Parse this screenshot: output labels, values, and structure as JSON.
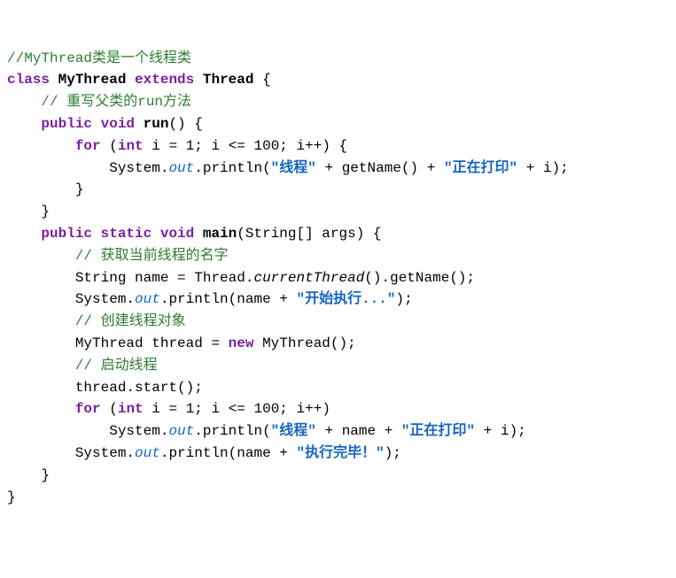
{
  "code": {
    "c1": "//MyThread类是一个线程类",
    "kw_class": "class",
    "id_MyThread": "MyThread",
    "kw_extends": "extends",
    "id_Thread": "Thread",
    "brace_open": "{",
    "brace_close": "}",
    "c2": "// 重写父类的run方法",
    "kw_public": "public",
    "kw_void": "void",
    "fn_run": "run",
    "parens_empty": "()",
    "kw_for": "for",
    "paren_open": "(",
    "paren_close": ")",
    "kw_int": "int",
    "id_i": "i",
    "eq1": " = 1; ",
    "cond": " <= 100; ",
    "inc": "++",
    "id_System": "System.",
    "fi_out": "out",
    "call_println_open": ".println(",
    "str_thread": "\"线程\"",
    "plus": " + ",
    "call_getName": "getName()",
    "str_printing": "\"正在打印\"",
    "close_stmt": ");",
    "kw_static": "static",
    "fn_main": "main",
    "main_params": "(String[] args)",
    "c3": "// 获取当前线程的名字",
    "id_String": "String",
    "id_name": "name",
    "eq": " = ",
    "id_Thread2": "Thread.",
    "ci_currentThread": "currentThread",
    "call_getName2": "().getName();",
    "str_start": "\"开始执行...\"",
    "c4": "// 创建线程对象",
    "id_thread": "thread",
    "kw_new": "new",
    "ctor_MyThread": "MyThread();",
    "c5": "// 启动线程",
    "call_start": "thread.start();",
    "str_done": "\"执行完毕！\""
  }
}
